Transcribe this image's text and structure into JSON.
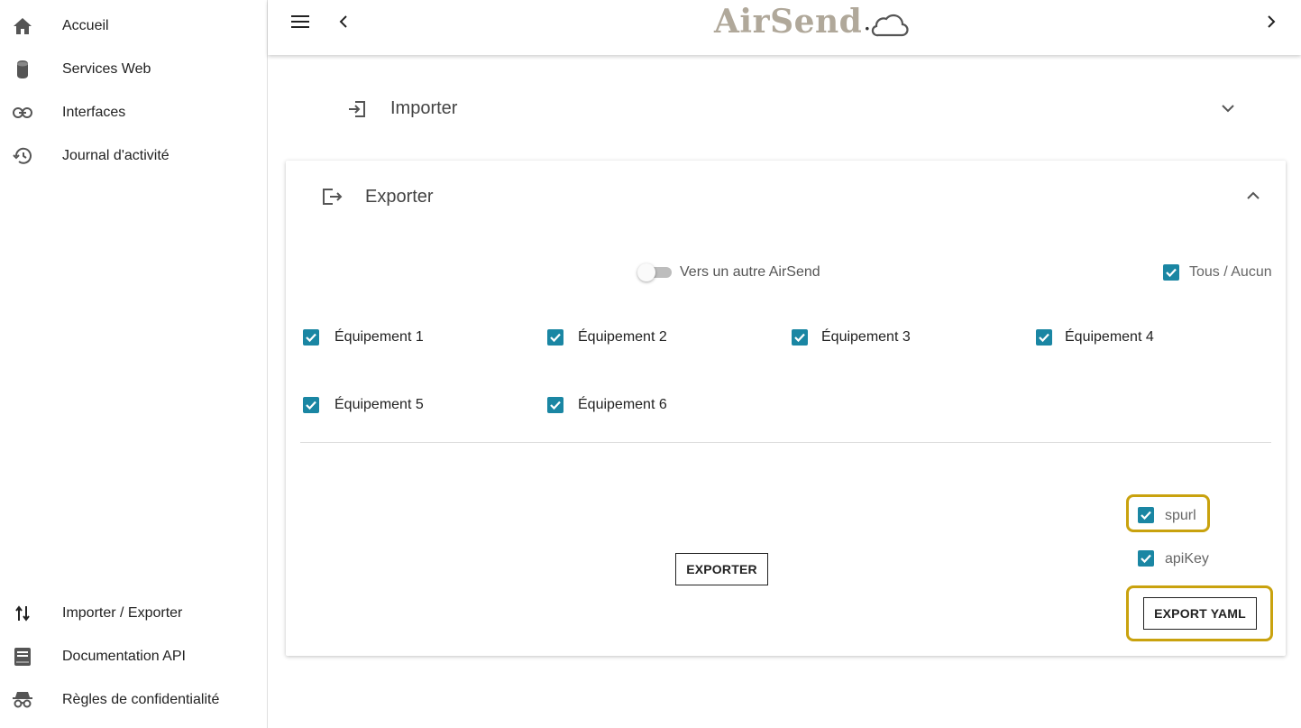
{
  "sidebar": {
    "top_items": [
      {
        "label": "Accueil",
        "icon": "home-icon"
      },
      {
        "label": "Services Web",
        "icon": "database-icon"
      },
      {
        "label": "Interfaces",
        "icon": "link-icon"
      },
      {
        "label": "Journal d'activité",
        "icon": "history-icon"
      }
    ],
    "bottom_items": [
      {
        "label": "Importer / Exporter",
        "icon": "import-export-icon"
      },
      {
        "label": "Documentation API",
        "icon": "book-icon"
      },
      {
        "label": "Règles de confidentialité",
        "icon": "incognito-icon"
      }
    ]
  },
  "header": {
    "logo_text": "AirSend",
    "logo_suffix": "."
  },
  "importer": {
    "title": "Importer"
  },
  "exporter": {
    "title": "Exporter",
    "toggle_label": "Vers un autre AirSend",
    "toggle_on": false,
    "all_none_label": "Tous / Aucun",
    "devices": [
      {
        "label": "Équipement 1",
        "checked": true
      },
      {
        "label": "Équipement 2",
        "checked": true
      },
      {
        "label": "Équipement 3",
        "checked": true
      },
      {
        "label": "Équipement 4",
        "checked": true
      },
      {
        "label": "Équipement 5",
        "checked": true
      },
      {
        "label": "Équipement 6",
        "checked": true
      }
    ],
    "export_button": "EXPORTER",
    "options": [
      {
        "label": "spurl",
        "checked": true
      },
      {
        "label": "apiKey",
        "checked": true
      }
    ],
    "export_yaml_button": "EXPORT YAML"
  },
  "colors": {
    "checkbox": "#1a86a3",
    "highlight": "#c9a20e",
    "logo": "#b0a89a"
  }
}
